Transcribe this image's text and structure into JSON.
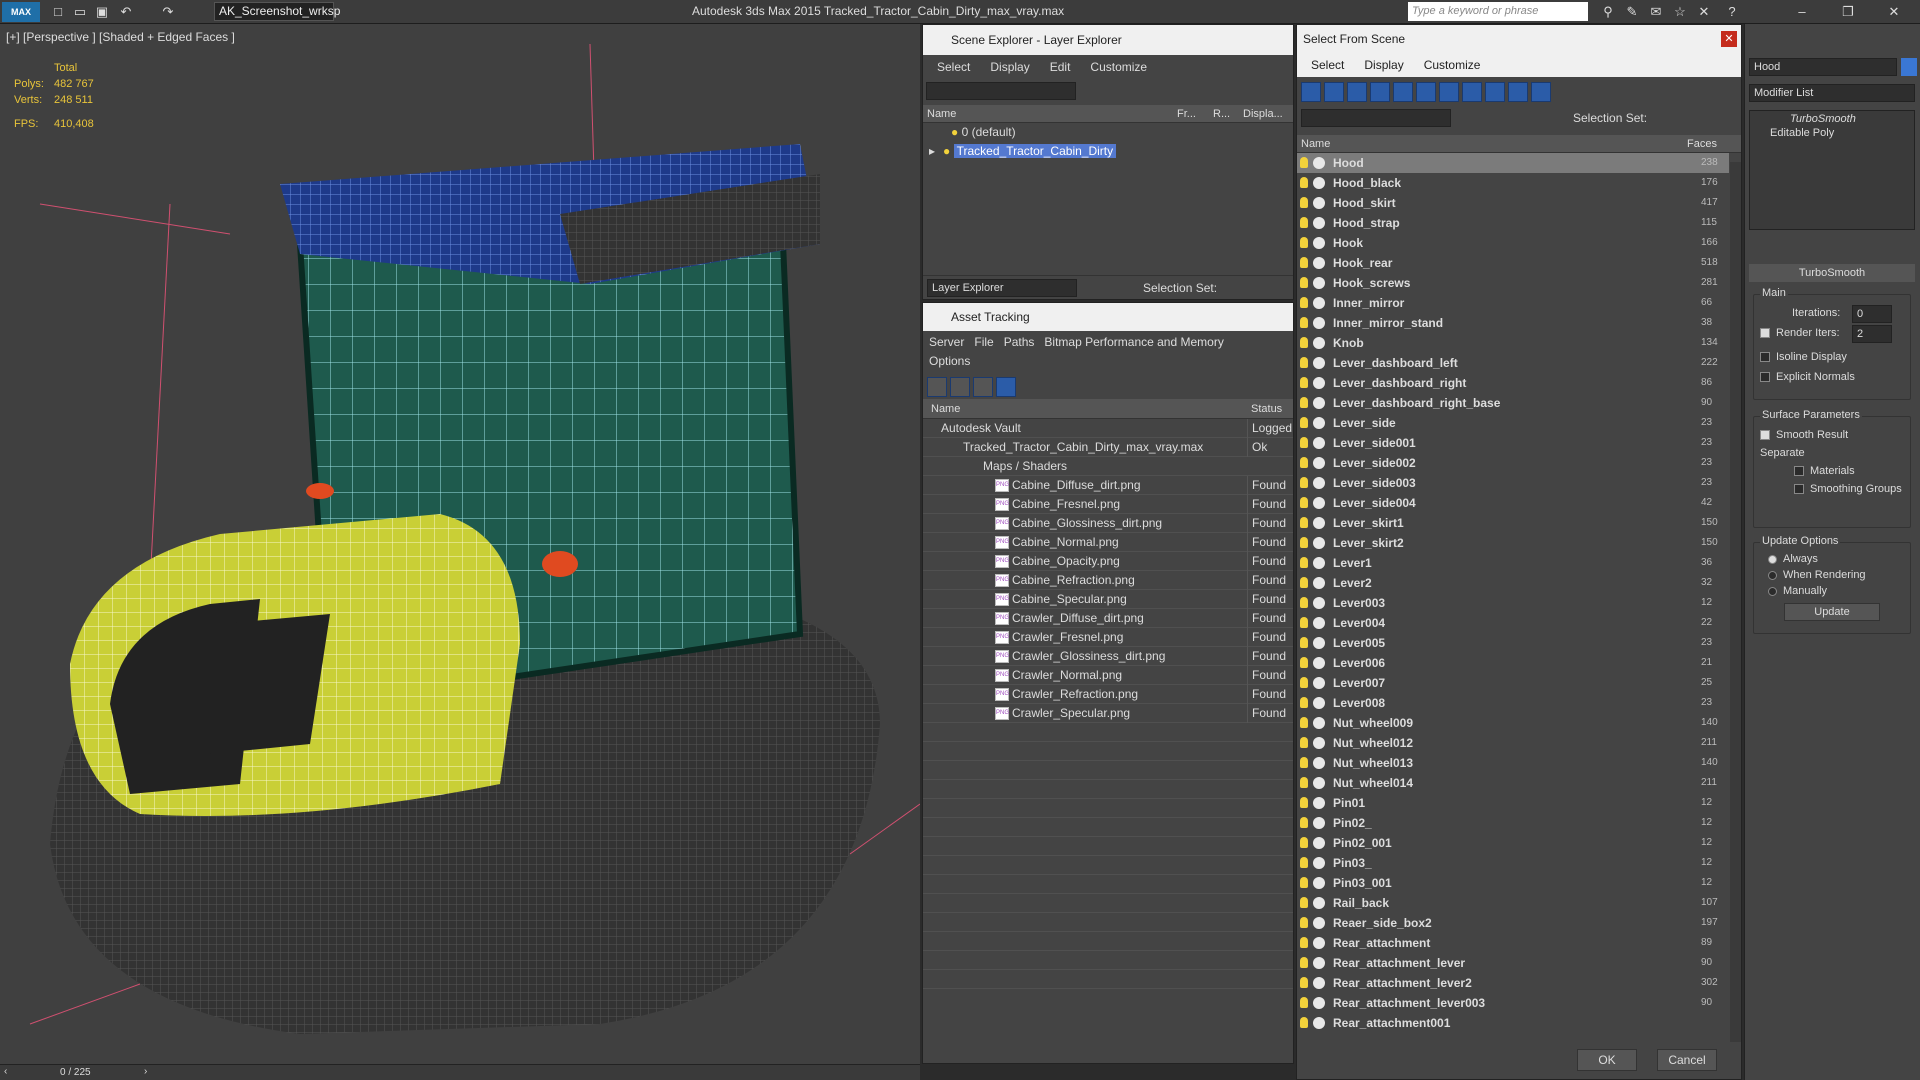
{
  "app": {
    "workspace": "AK_Screenshot_wrksp",
    "title": "Autodesk 3ds Max  2015    Tracked_Tractor_Cabin_Dirty_max_vray.max",
    "search_placeholder": "Type a keyword or phrase"
  },
  "viewport": {
    "label": "[+] [Perspective ] [Shaded + Edged Faces ]",
    "stats": {
      "total": "Total",
      "polys_k": "Polys:",
      "polys_v": "482 767",
      "verts_k": "Verts:",
      "verts_v": "248 511",
      "fps_k": "FPS:",
      "fps_v": "410,408"
    },
    "frame": "0 / 225"
  },
  "scene_explorer": {
    "title": "Scene Explorer - Layer Explorer",
    "menu": [
      "Select",
      "Display",
      "Edit",
      "Customize"
    ],
    "cols": [
      "Name",
      "Fr...",
      "R...",
      "Displa..."
    ],
    "layers": [
      "0 (default)",
      "Tracked_Tractor_Cabin_Dirty"
    ],
    "footer_label": "Layer Explorer",
    "selection_set": "Selection Set:"
  },
  "asset_tracking": {
    "title": "Asset Tracking",
    "menu": [
      "Server",
      "File",
      "Paths",
      "Bitmap Performance and Memory",
      "Options"
    ],
    "cols": [
      "Name",
      "Status"
    ],
    "rows": [
      {
        "name": "Autodesk Vault",
        "status": "Logged"
      },
      {
        "name": "Tracked_Tractor_Cabin_Dirty_max_vray.max",
        "status": "Ok"
      },
      {
        "name": "Maps / Shaders",
        "status": ""
      },
      {
        "name": "Cabine_Diffuse_dirt.png",
        "status": "Found"
      },
      {
        "name": "Cabine_Fresnel.png",
        "status": "Found"
      },
      {
        "name": "Cabine_Glossiness_dirt.png",
        "status": "Found"
      },
      {
        "name": "Cabine_Normal.png",
        "status": "Found"
      },
      {
        "name": "Cabine_Opacity.png",
        "status": "Found"
      },
      {
        "name": "Cabine_Refraction.png",
        "status": "Found"
      },
      {
        "name": "Cabine_Specular.png",
        "status": "Found"
      },
      {
        "name": "Crawler_Diffuse_dirt.png",
        "status": "Found"
      },
      {
        "name": "Crawler_Fresnel.png",
        "status": "Found"
      },
      {
        "name": "Crawler_Glossiness_dirt.png",
        "status": "Found"
      },
      {
        "name": "Crawler_Normal.png",
        "status": "Found"
      },
      {
        "name": "Crawler_Refraction.png",
        "status": "Found"
      },
      {
        "name": "Crawler_Specular.png",
        "status": "Found"
      }
    ]
  },
  "select_from_scene": {
    "title": "Select From Scene",
    "menu": [
      "Select",
      "Display",
      "Customize"
    ],
    "selection_set": "Selection Set:",
    "cols": [
      "Name",
      "Faces"
    ],
    "rows": [
      {
        "n": "Hood",
        "f": "238"
      },
      {
        "n": "Hood_black",
        "f": "176"
      },
      {
        "n": "Hood_skirt",
        "f": "417"
      },
      {
        "n": "Hood_strap",
        "f": "115"
      },
      {
        "n": "Hook",
        "f": "166"
      },
      {
        "n": "Hook_rear",
        "f": "518"
      },
      {
        "n": "Hook_screws",
        "f": "281"
      },
      {
        "n": "Inner_mirror",
        "f": "66"
      },
      {
        "n": "Inner_mirror_stand",
        "f": "38"
      },
      {
        "n": "Knob",
        "f": "134"
      },
      {
        "n": "Lever_dashboard_left",
        "f": "222"
      },
      {
        "n": "Lever_dashboard_right",
        "f": "86"
      },
      {
        "n": "Lever_dashboard_right_base",
        "f": "90"
      },
      {
        "n": "Lever_side",
        "f": "23"
      },
      {
        "n": "Lever_side001",
        "f": "23"
      },
      {
        "n": "Lever_side002",
        "f": "23"
      },
      {
        "n": "Lever_side003",
        "f": "23"
      },
      {
        "n": "Lever_side004",
        "f": "42"
      },
      {
        "n": "Lever_skirt1",
        "f": "150"
      },
      {
        "n": "Lever_skirt2",
        "f": "150"
      },
      {
        "n": "Lever1",
        "f": "36"
      },
      {
        "n": "Lever2",
        "f": "32"
      },
      {
        "n": "Lever003",
        "f": "12"
      },
      {
        "n": "Lever004",
        "f": "22"
      },
      {
        "n": "Lever005",
        "f": "23"
      },
      {
        "n": "Lever006",
        "f": "21"
      },
      {
        "n": "Lever007",
        "f": "25"
      },
      {
        "n": "Lever008",
        "f": "23"
      },
      {
        "n": "Nut_wheel009",
        "f": "140"
      },
      {
        "n": "Nut_wheel012",
        "f": "211"
      },
      {
        "n": "Nut_wheel013",
        "f": "140"
      },
      {
        "n": "Nut_wheel014",
        "f": "211"
      },
      {
        "n": "Pin01",
        "f": "12"
      },
      {
        "n": "Pin02_",
        "f": "12"
      },
      {
        "n": "Pin02_001",
        "f": "12"
      },
      {
        "n": "Pin03_",
        "f": "12"
      },
      {
        "n": "Pin03_001",
        "f": "12"
      },
      {
        "n": "Rail_back",
        "f": "107"
      },
      {
        "n": "Reaer_side_box2",
        "f": "197"
      },
      {
        "n": "Rear_attachment",
        "f": "89"
      },
      {
        "n": "Rear_attachment_lever",
        "f": "90"
      },
      {
        "n": "Rear_attachment_lever2",
        "f": "302"
      },
      {
        "n": "Rear_attachment_lever003",
        "f": "90"
      },
      {
        "n": "Rear_attachment001",
        "f": ""
      }
    ],
    "ok": "OK",
    "cancel": "Cancel"
  },
  "command_panel": {
    "object_name": "Hood",
    "modifier_list": "Modifier List",
    "stack": [
      "TurboSmooth",
      "Editable Poly"
    ],
    "rollout": "TurboSmooth",
    "main": "Main",
    "iterations_label": "Iterations:",
    "iterations": "0",
    "render_iters_label": "Render Iters:",
    "render_iters": "2",
    "isoline": "Isoline Display",
    "explicit": "Explicit Normals",
    "surface": "Surface Parameters",
    "smooth_result": "Smooth Result",
    "separate": "Separate",
    "materials": "Materials",
    "smoothing_groups": "Smoothing Groups",
    "update_options": "Update Options",
    "always": "Always",
    "when_rendering": "When Rendering",
    "manually": "Manually",
    "update": "Update"
  }
}
